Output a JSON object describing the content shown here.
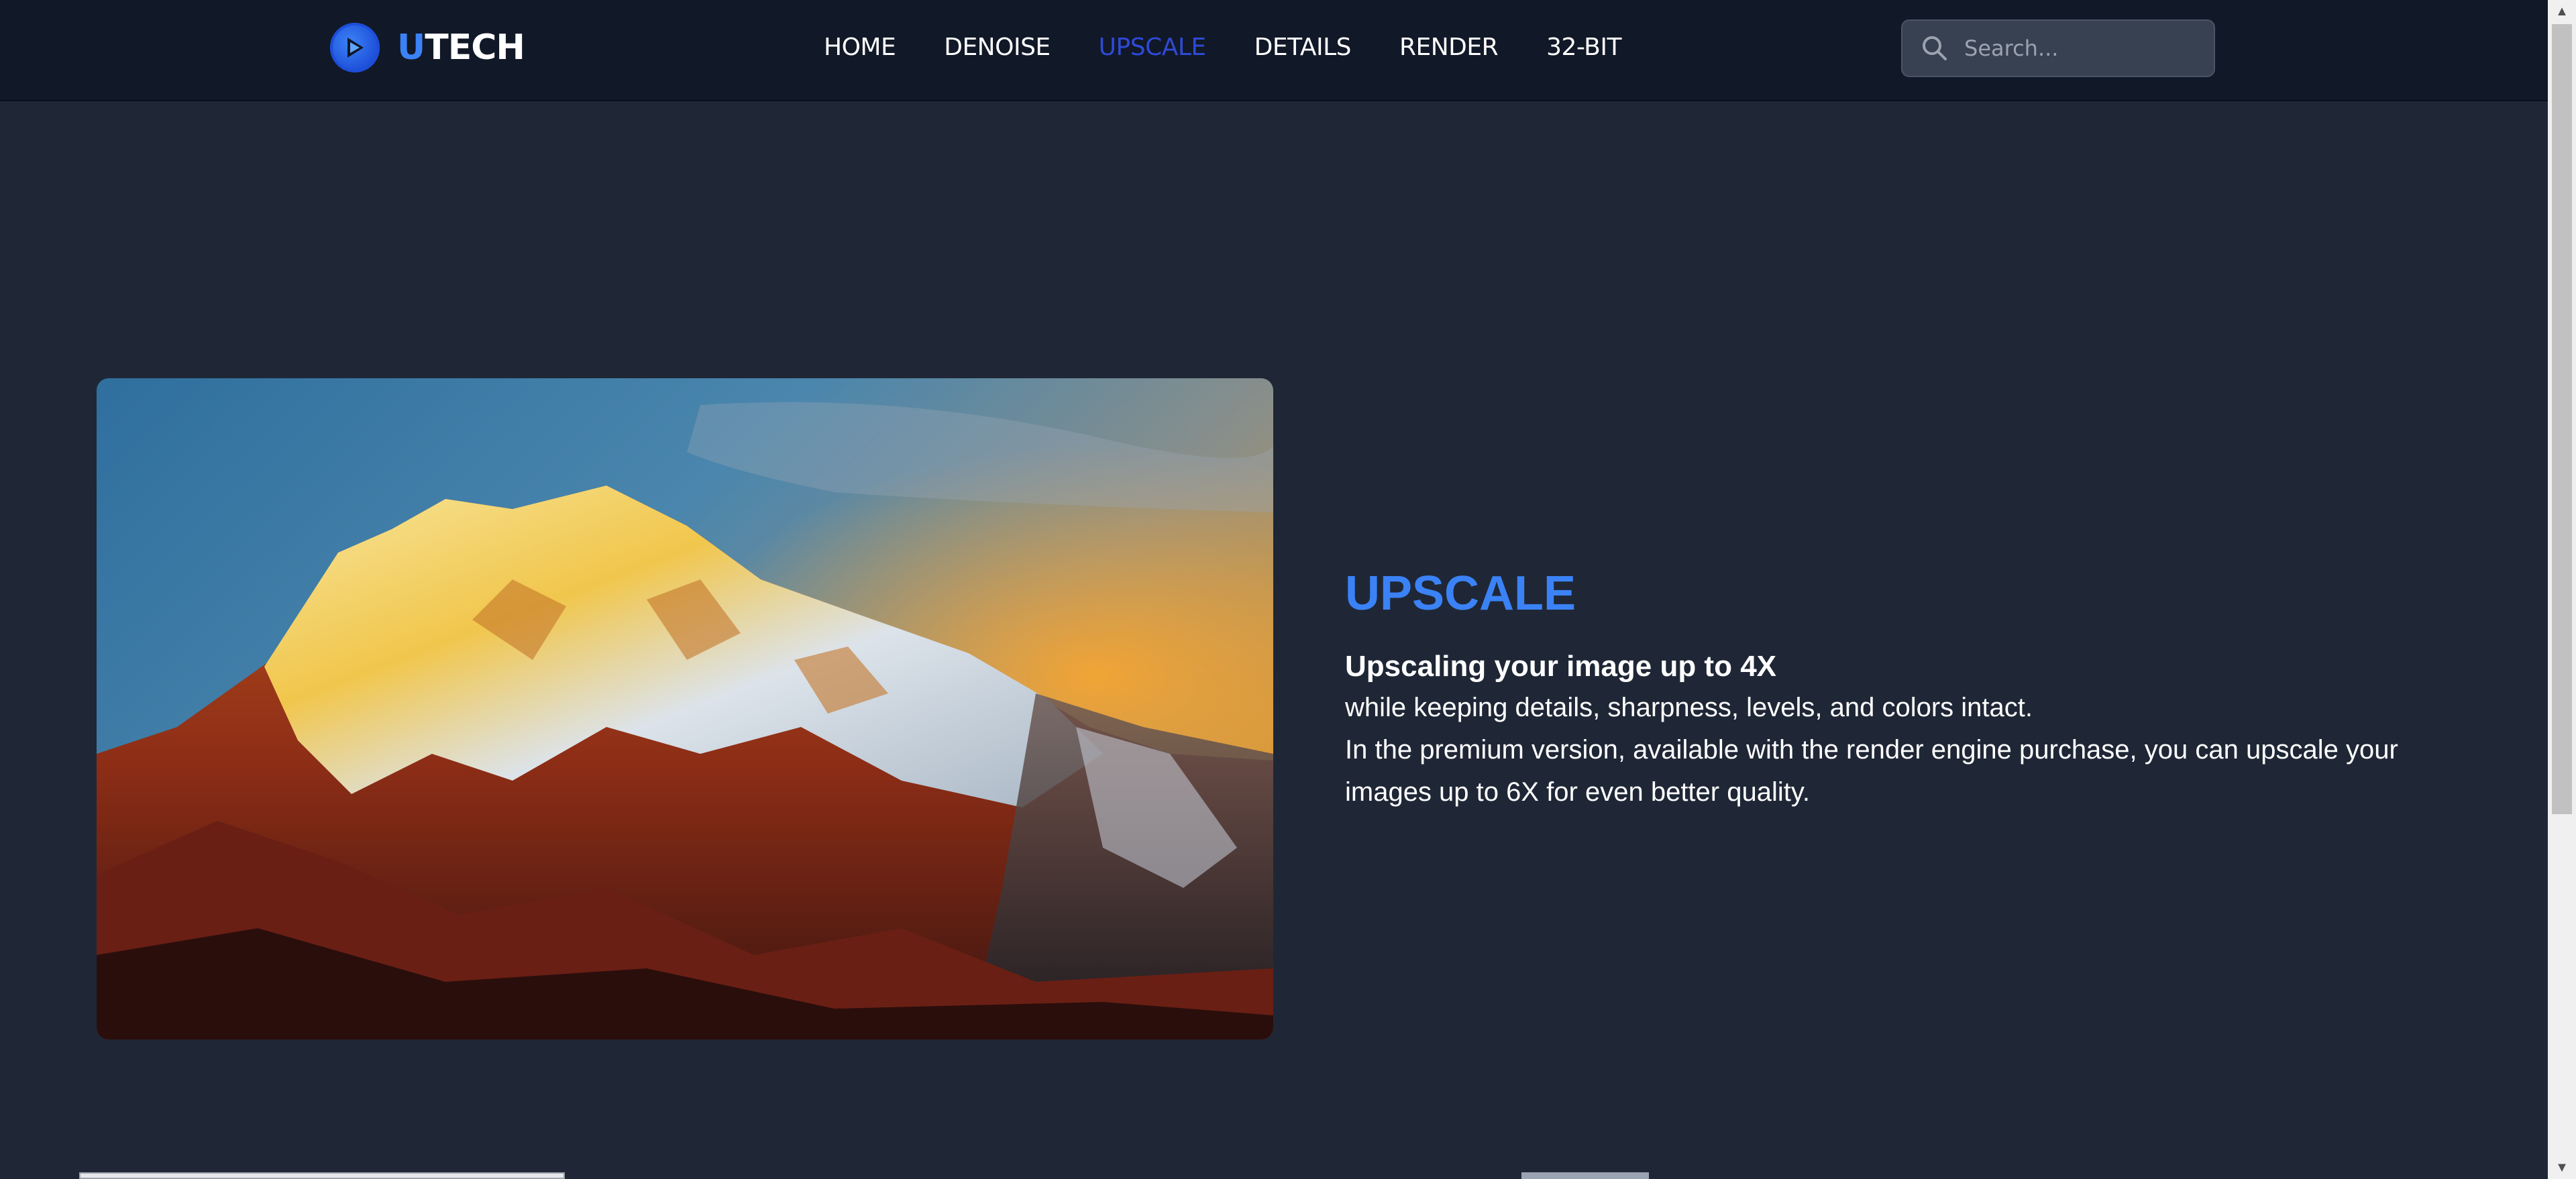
{
  "brand": {
    "name_accent": "U",
    "name_rest": "TECH"
  },
  "nav": {
    "items": [
      {
        "label": "HOME",
        "active": false
      },
      {
        "label": "DENOISE",
        "active": false
      },
      {
        "label": "UPSCALE",
        "active": true
      },
      {
        "label": "DETAILS",
        "active": false
      },
      {
        "label": "RENDER",
        "active": false
      },
      {
        "label": "32-BIT",
        "active": false
      }
    ]
  },
  "search": {
    "placeholder": "Search...",
    "value": "",
    "icon": "search-icon"
  },
  "hero": {
    "image_icon": "mountain-sunset-photo",
    "title": "UPSCALE",
    "subtitle": "Upscaling your image up to 4X",
    "line1": "while keeping details, sharpness, levels, and colors intact.",
    "line2": "In the premium version, available with the render engine purchase, you can upscale your",
    "line3": "images up to 6X for even better quality."
  },
  "colors": {
    "accent": "#3b82f6",
    "nav_active": "#2f4ad6",
    "header_bg": "#111827",
    "page_bg": "#1f2736"
  }
}
